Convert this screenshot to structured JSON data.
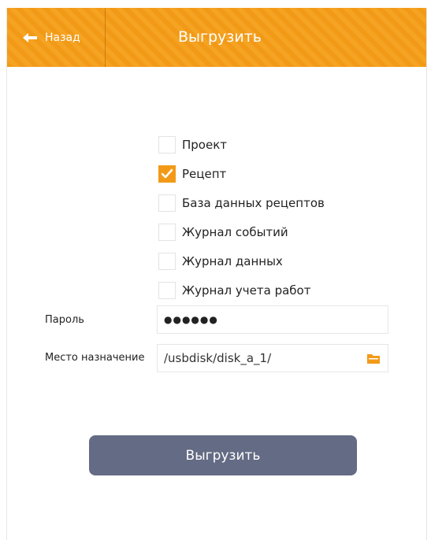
{
  "header": {
    "back_label": "Назад",
    "title": "Выгрузить"
  },
  "options": [
    {
      "label": "Проект",
      "checked": false
    },
    {
      "label": "Рецепт",
      "checked": true
    },
    {
      "label": "База данных рецептов",
      "checked": false
    },
    {
      "label": "Журнал событий",
      "checked": false
    },
    {
      "label": "Журнал данных",
      "checked": false
    },
    {
      "label": "Журнал учета работ",
      "checked": false
    }
  ],
  "password": {
    "label": "Пароль",
    "value": "●●●●●●"
  },
  "destination": {
    "label": "Место назначение",
    "value": "/usbdisk/disk_a_1/"
  },
  "submit_label": "Выгрузить",
  "colors": {
    "accent": "#f29a18",
    "button": "#646b84"
  },
  "icons": {
    "back": "arrow-left-icon",
    "folder": "folder-icon",
    "check": "checkmark-icon"
  }
}
